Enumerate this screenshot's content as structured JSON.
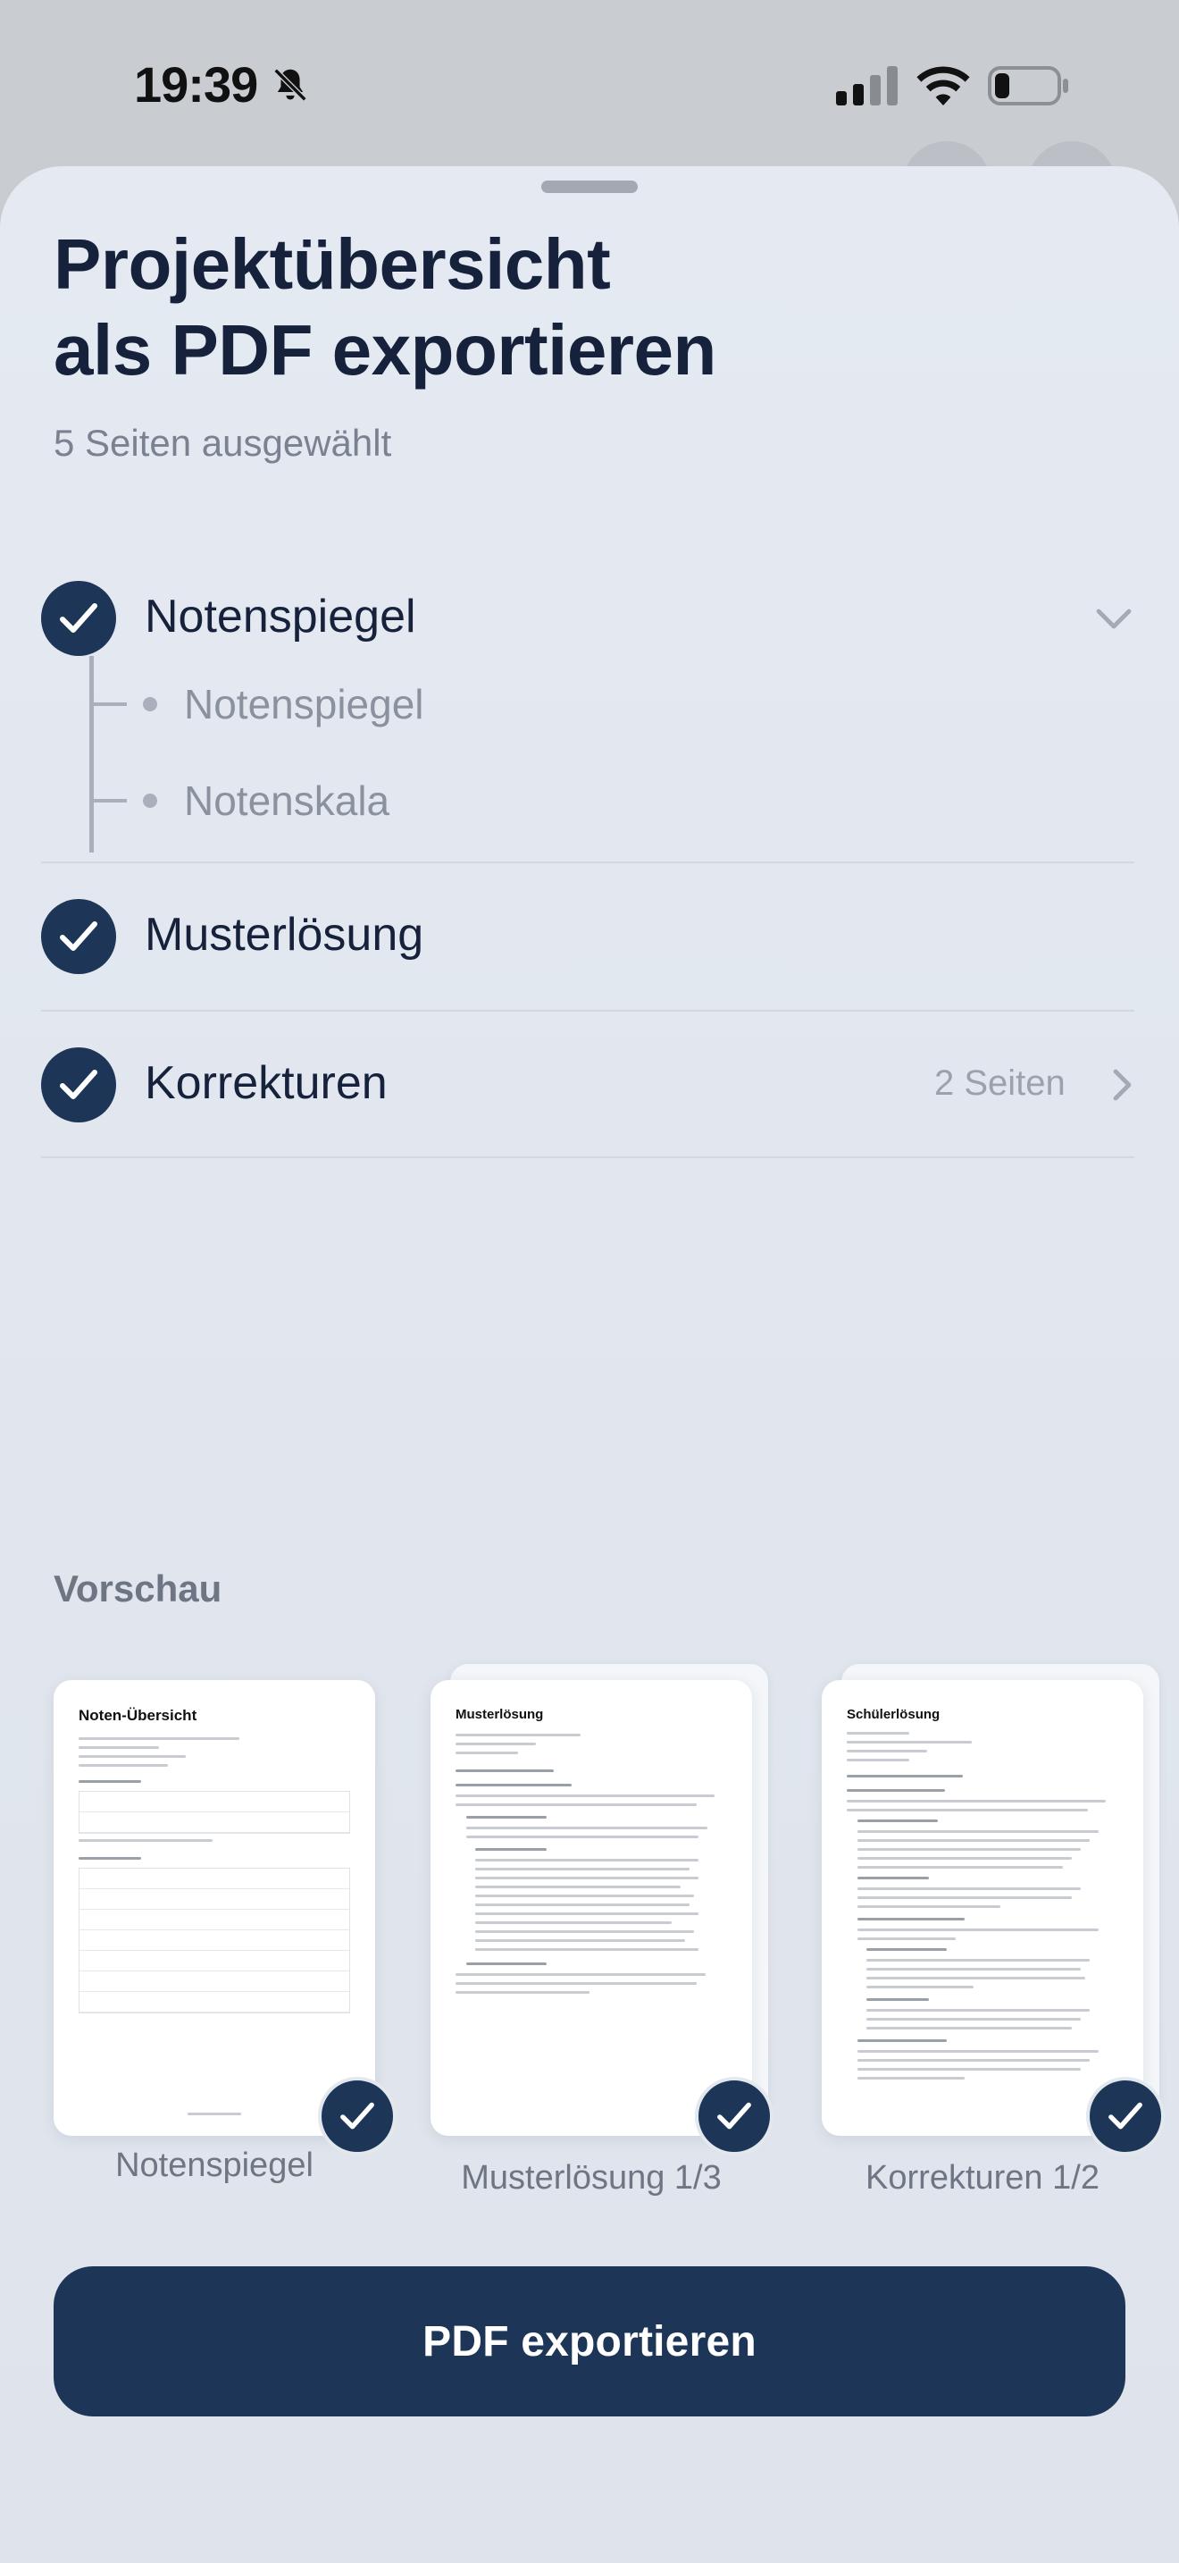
{
  "status_bar": {
    "time": "19:39",
    "icons": [
      "bell-slash-icon",
      "cellular-signal-icon",
      "wifi-icon",
      "battery-icon"
    ]
  },
  "sheet": {
    "title_line1": "Projektübersicht",
    "title_line2": "als PDF exportieren",
    "subtitle": "5 Seiten ausgewählt"
  },
  "sections": [
    {
      "label": "Notenspiegel",
      "checked": true,
      "expanded": true,
      "children": [
        "Notenspiegel",
        "Notenskala"
      ]
    },
    {
      "label": "Musterlösung",
      "checked": true
    },
    {
      "label": "Korrekturen",
      "checked": true,
      "meta": "2 Seiten"
    }
  ],
  "preview": {
    "title": "Vorschau",
    "cards": [
      {
        "label": "Notenspiegel",
        "doc_title": "Noten-Übersicht",
        "checked": true
      },
      {
        "label": "Musterlösung 1/3",
        "doc_title": "Musterlösung",
        "checked": true
      },
      {
        "label": "Korrekturen 1/2",
        "doc_title": "Schülerlösung",
        "checked": true
      }
    ]
  },
  "actions": {
    "export_label": "PDF exportieren"
  },
  "colors": {
    "accent": "#1d3557",
    "title": "#16213b",
    "muted": "#7a8291",
    "sheet_bg": "#e3e8ef"
  }
}
